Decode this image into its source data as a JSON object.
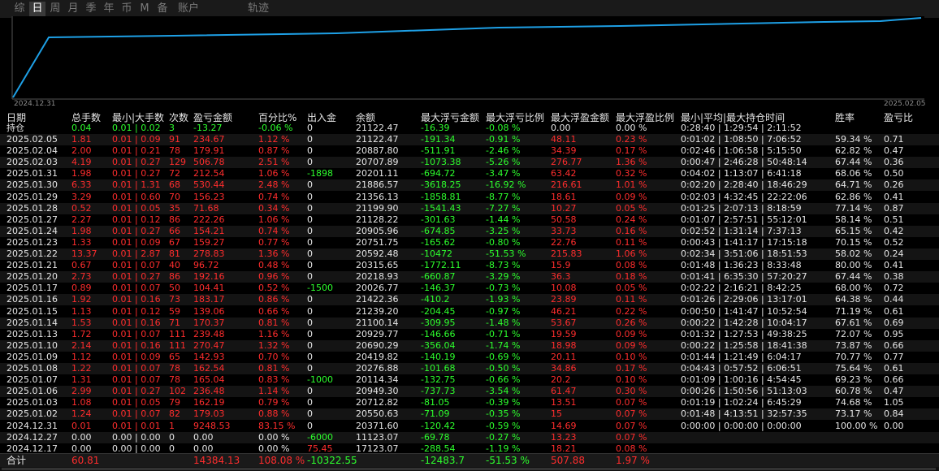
{
  "tabs": [
    "综",
    "日",
    "周",
    "月",
    "季",
    "年",
    "币",
    "M",
    "备",
    "账户",
    "轨迹"
  ],
  "active_tab": "日",
  "chart": {
    "start_date": "2024.12.31",
    "end_date": "2025.02.05",
    "line_color": "#1ea0e6"
  },
  "table": {
    "headers": [
      "日期",
      "总手数",
      "最小|大手数",
      "次数",
      "盈亏金额",
      "百分比%",
      "出入金",
      "余额",
      "最大浮亏金额",
      "最大浮亏比例",
      "最大浮盈金额",
      "最大浮盈比例",
      "最小|平均|最大持仓时间",
      "胜率",
      "盈亏比"
    ],
    "holding": [
      "持仓",
      "0.04",
      "0.01 | 0.02",
      "3",
      "-13.27",
      "-0.06 %",
      "0",
      "21122.47",
      "-16.39",
      "-0.08 %",
      "0.00",
      "0.00 %",
      "0:28:40 | 1:29:54 | 2:11:52",
      "",
      ""
    ],
    "rows": [
      [
        "2025.02.05",
        "1.81",
        "0.01 | 0.09",
        "91",
        "234.67",
        "1.12 %",
        "0",
        "21122.47",
        "-191.34",
        "-0.91 %",
        "48.11",
        "0.23 %",
        "0:01:02 | 1:08:50 | 7:06:52",
        "59.34 %",
        "0.71"
      ],
      [
        "2025.02.04",
        "2.00",
        "0.01 | 0.21",
        "78",
        "179.91",
        "0.87 %",
        "0",
        "20887.80",
        "-511.91",
        "-2.46 %",
        "34.39",
        "0.17 %",
        "0:02:46 | 1:06:58 | 5:15:50",
        "62.82 %",
        "0.47"
      ],
      [
        "2025.02.03",
        "4.19",
        "0.01 | 0.27",
        "129",
        "506.78",
        "2.51 %",
        "0",
        "20707.89",
        "-1073.38",
        "-5.26 %",
        "276.77",
        "1.36 %",
        "0:00:47 | 2:46:28 | 50:48:14",
        "67.44 %",
        "0.36"
      ],
      [
        "2025.01.31",
        "1.98",
        "0.01 | 0.27",
        "72",
        "212.54",
        "1.06 %",
        "-1898",
        "20201.11",
        "-694.72",
        "-3.47 %",
        "63.42",
        "0.32 %",
        "0:04:02 | 1:13:07 | 6:41:18",
        "68.06 %",
        "0.50"
      ],
      [
        "2025.01.30",
        "6.33",
        "0.01 | 1.31",
        "68",
        "530.44",
        "2.48 %",
        "0",
        "21886.57",
        "-3618.25",
        "-16.92 %",
        "216.61",
        "1.01 %",
        "0:02:20 | 2:28:40 | 18:46:29",
        "64.71 %",
        "0.26"
      ],
      [
        "2025.01.29",
        "3.29",
        "0.01 | 0.60",
        "70",
        "156.23",
        "0.74 %",
        "0",
        "21356.13",
        "-1858.81",
        "-8.77 %",
        "18.61",
        "0.09 %",
        "0:02:03 | 4:32:45 | 22:22:06",
        "62.86 %",
        "0.41"
      ],
      [
        "2025.01.28",
        "0.52",
        "0.01 | 0.05",
        "35",
        "71.68",
        "0.34 %",
        "0",
        "21199.90",
        "-1541.43",
        "-7.27 %",
        "10.27",
        "0.05 %",
        "0:01:25 | 2:07:13 | 8:18:59",
        "77.14 %",
        "0.87"
      ],
      [
        "2025.01.27",
        "2.27",
        "0.01 | 0.12",
        "86",
        "222.26",
        "1.06 %",
        "0",
        "21128.22",
        "-301.63",
        "-1.44 %",
        "50.58",
        "0.24 %",
        "0:01:07 | 2:57:51 | 55:12:01",
        "58.14 %",
        "0.51"
      ],
      [
        "2025.01.24",
        "1.98",
        "0.01 | 0.27",
        "66",
        "154.21",
        "0.74 %",
        "0",
        "20905.96",
        "-674.85",
        "-3.25 %",
        "33.73",
        "0.16 %",
        "0:02:52 | 1:31:14 | 7:37:13",
        "65.15 %",
        "0.42"
      ],
      [
        "2025.01.23",
        "1.33",
        "0.01 | 0.09",
        "67",
        "159.27",
        "0.77 %",
        "0",
        "20751.75",
        "-165.62",
        "-0.80 %",
        "22.76",
        "0.11 %",
        "0:00:43 | 1:41:17 | 17:15:18",
        "70.15 %",
        "0.52"
      ],
      [
        "2025.01.22",
        "13.37",
        "0.01 | 2.87",
        "81",
        "278.83",
        "1.36 %",
        "0",
        "20592.48",
        "-10472",
        "-51.53 %",
        "215.83",
        "1.06 %",
        "0:02:34 | 3:51:06 | 18:51:53",
        "58.02 %",
        "0.24"
      ],
      [
        "2025.01.21",
        "0.67",
        "0.01 | 0.07",
        "40",
        "96.72",
        "0.48 %",
        "0",
        "20315.65",
        "-1772.11",
        "-8.73 %",
        "15.9",
        "0.08 %",
        "0:01:48 | 1:36:23 | 8:33:48",
        "80.00 %",
        "0.41"
      ],
      [
        "2025.01.20",
        "2.73",
        "0.01 | 0.27",
        "86",
        "192.16",
        "0.96 %",
        "0",
        "20218.93",
        "-660.87",
        "-3.29 %",
        "36.3",
        "0.18 %",
        "0:01:41 | 6:35:30 | 57:20:27",
        "67.44 %",
        "0.38"
      ],
      [
        "2025.01.17",
        "0.89",
        "0.01 | 0.07",
        "50",
        "104.41",
        "0.52 %",
        "-1500",
        "20026.77",
        "-146.37",
        "-0.73 %",
        "10.08",
        "0.05 %",
        "0:02:22 | 2:16:21 | 8:42:25",
        "68.00 %",
        "0.72"
      ],
      [
        "2025.01.16",
        "1.92",
        "0.01 | 0.16",
        "73",
        "183.17",
        "0.86 %",
        "0",
        "21422.36",
        "-410.2",
        "-1.93 %",
        "23.89",
        "0.11 %",
        "0:01:26 | 2:29:06 | 13:17:01",
        "64.38 %",
        "0.44"
      ],
      [
        "2025.01.15",
        "1.13",
        "0.01 | 0.12",
        "59",
        "139.06",
        "0.66 %",
        "0",
        "21239.20",
        "-204.45",
        "-0.97 %",
        "46.21",
        "0.22 %",
        "0:00:50 | 1:41:47 | 10:52:54",
        "71.19 %",
        "0.61"
      ],
      [
        "2025.01.14",
        "1.53",
        "0.01 | 0.16",
        "71",
        "170.37",
        "0.81 %",
        "0",
        "21100.14",
        "-309.95",
        "-1.48 %",
        "53.67",
        "0.26 %",
        "0:00:22 | 1:42:28 | 10:04:17",
        "67.61 %",
        "0.69"
      ],
      [
        "2025.01.13",
        "1.72",
        "0.01 | 0.07",
        "111",
        "239.48",
        "1.16 %",
        "0",
        "20929.77",
        "-146.66",
        "-0.71 %",
        "19.59",
        "0.09 %",
        "0:01:32 | 1:27:53 | 49:38:25",
        "72.07 %",
        "0.95"
      ],
      [
        "2025.01.10",
        "2.14",
        "0.01 | 0.16",
        "111",
        "270.47",
        "1.32 %",
        "0",
        "20690.29",
        "-356.04",
        "-1.74 %",
        "18.98",
        "0.09 %",
        "0:00:22 | 1:25:58 | 18:41:38",
        "73.87 %",
        "0.66"
      ],
      [
        "2025.01.09",
        "1.12",
        "0.01 | 0.09",
        "65",
        "142.93",
        "0.70 %",
        "0",
        "20419.82",
        "-140.19",
        "-0.69 %",
        "20.11",
        "0.10 %",
        "0:01:44 | 1:21:49 | 6:04:17",
        "70.77 %",
        "0.77"
      ],
      [
        "2025.01.08",
        "1.22",
        "0.01 | 0.07",
        "78",
        "162.54",
        "0.81 %",
        "0",
        "20276.88",
        "-101.68",
        "-0.50 %",
        "34.86",
        "0.17 %",
        "0:04:43 | 0:57:52 | 6:06:51",
        "75.64 %",
        "0.61"
      ],
      [
        "2025.01.07",
        "1.31",
        "0.01 | 0.07",
        "78",
        "165.04",
        "0.83 %",
        "-1000",
        "20114.34",
        "-132.75",
        "-0.66 %",
        "20.2",
        "0.10 %",
        "0:01:09 | 1:00:16 | 4:54:45",
        "69.23 %",
        "0.66"
      ],
      [
        "2025.01.06",
        "2.99",
        "0.01 | 0.27",
        "102",
        "236.48",
        "1.14 %",
        "0",
        "20949.30",
        "-737.73",
        "-3.54 %",
        "61.47",
        "0.30 %",
        "0:00:26 | 1:50:56 | 51:13:03",
        "60.78 %",
        "0.47"
      ],
      [
        "2025.01.03",
        "1.08",
        "0.01 | 0.05",
        "79",
        "162.19",
        "0.79 %",
        "0",
        "20712.82",
        "-81.05",
        "-0.39 %",
        "13.51",
        "0.07 %",
        "0:01:19 | 1:02:24 | 6:45:29",
        "74.68 %",
        "1.05"
      ],
      [
        "2025.01.02",
        "1.24",
        "0.01 | 0.07",
        "82",
        "179.03",
        "0.88 %",
        "0",
        "20550.63",
        "-71.09",
        "-0.35 %",
        "15",
        "0.07 %",
        "0:01:48 | 4:13:51 | 32:57:35",
        "73.17 %",
        "0.84"
      ],
      [
        "2024.12.31",
        "0.01",
        "0.01 | 0.01",
        "1",
        "9248.53",
        "83.15 %",
        "0",
        "20371.60",
        "-120.42",
        "-0.59 %",
        "14.69",
        "0.07 %",
        "0:00:00 | 0:00:00 | 0:00:00",
        "100.00 %",
        "0.00"
      ],
      [
        "2024.12.27",
        "0.00",
        "0.00 | 0.00",
        "0",
        "0.00",
        "0.00 %",
        "-6000",
        "11123.07",
        "-69.78",
        "-0.27 %",
        "13.23",
        "0.07 %",
        "",
        "",
        ""
      ],
      [
        "2024.12.17",
        "0.00",
        "0.00 | 0.00",
        "0",
        "0.00",
        "0.00 %",
        "75.45",
        "17123.07",
        "-288.54",
        "-1.19 %",
        "18.21",
        "0.08 %",
        "",
        "",
        ""
      ]
    ],
    "total": [
      "合计",
      "60.81",
      "",
      "",
      "14384.13",
      "108.08 %",
      "-10322.55",
      "",
      "-12483.7",
      "-51.53 %",
      "507.88",
      "1.97 %",
      "",
      "",
      ""
    ]
  },
  "colors": {
    "positive": "#ff2d2d",
    "negative": "#2dff2d",
    "neutral": "#e6e6e6",
    "chart_line": "#1ea0e6"
  }
}
